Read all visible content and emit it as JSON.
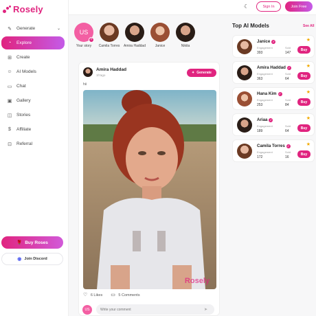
{
  "brand": {
    "name": "Rosely",
    "accent": "#e0247f",
    "accent2": "#c45be8"
  },
  "sidebar": {
    "items": [
      {
        "label": "Generate",
        "icon": "magic-wand-icon",
        "glyph": "✎",
        "active": false,
        "chevron": "⌄"
      },
      {
        "label": "Explore",
        "icon": "compass-icon",
        "glyph": "◔",
        "active": true
      },
      {
        "label": "Create",
        "icon": "plus-square-icon",
        "glyph": "⊞",
        "active": false
      },
      {
        "label": "AI Models",
        "icon": "user-icon",
        "glyph": "☺",
        "active": false
      },
      {
        "label": "Chat",
        "icon": "chat-icon",
        "glyph": "▭",
        "active": false
      },
      {
        "label": "Gallery",
        "icon": "image-icon",
        "glyph": "▣",
        "active": false
      },
      {
        "label": "Stories",
        "icon": "stories-icon",
        "glyph": "◫",
        "active": false
      },
      {
        "label": "Affiliate",
        "icon": "dollar-icon",
        "glyph": "$",
        "active": false
      },
      {
        "label": "Referral",
        "icon": "gift-icon",
        "glyph": "⊡",
        "active": false
      }
    ],
    "buy_roses": "Buy Roses",
    "join_discord": "Join Discord"
  },
  "topbar": {
    "signin": "Sign In",
    "join_free": "Join Free",
    "theme_icon": "moon-icon"
  },
  "stories": {
    "mine": {
      "initials": "US",
      "label": "Your story"
    },
    "items": [
      {
        "name": "Camila Torres"
      },
      {
        "name": "Amira Haddad"
      },
      {
        "name": "Janice"
      },
      {
        "name": "Nikita"
      }
    ]
  },
  "post": {
    "user": "Amira Haddad",
    "time": "1h'ago",
    "caption": "hii",
    "generate_label": "Generate",
    "watermark": "Rosely",
    "likes": "6 Likes",
    "comments": "5 Comments"
  },
  "comment": {
    "initials": "US",
    "placeholder": "Write your comment"
  },
  "top_models": {
    "title": "Top AI Models",
    "see_all": "See All",
    "engagement_label": "Engagement",
    "sold_label": "Sold",
    "buy_label": "Buy",
    "models": [
      {
        "name": "Janice",
        "engagement": "393",
        "sold": "147"
      },
      {
        "name": "Amira Haddad",
        "engagement": "363",
        "sold": "64"
      },
      {
        "name": "Hana Kim",
        "engagement": "253",
        "sold": "84"
      },
      {
        "name": "Ariaa",
        "engagement": "189",
        "sold": "64"
      },
      {
        "name": "Camila Torres",
        "engagement": "172",
        "sold": "16"
      }
    ]
  }
}
